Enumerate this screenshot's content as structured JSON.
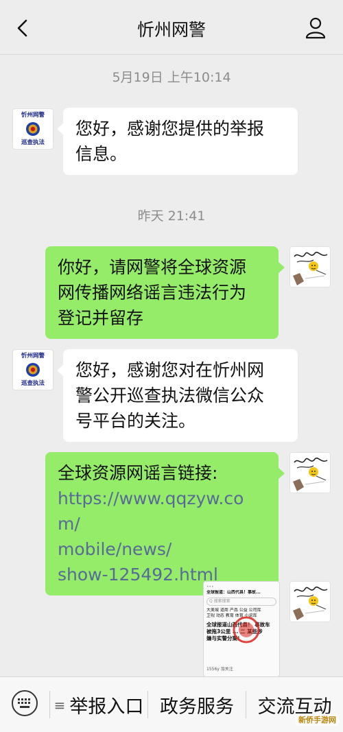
{
  "header": {
    "title": "忻州网警"
  },
  "chat": {
    "timestamp1": "5月19日 上午10:14",
    "timestamp2": "昨天 21:41",
    "msg1": [
      "您好，感谢您提供的举报",
      "信息。"
    ],
    "msg2": [
      "你好，请网警将全球资源",
      "网传播网络谣言违法行为",
      "登记并留存"
    ],
    "msg3": [
      "您好，感谢您对在忻州网",
      "警公开巡查执法微信公众",
      "号平台的关注。"
    ],
    "msg4_prefix": "全球资源网谣言链接:",
    "msg4_link": [
      "https://www.qqzyw.com/",
      "mobile/news/",
      "show-125492.html"
    ]
  },
  "police_avatar": {
    "line1": "忻州网警",
    "line2": "巡查执法"
  },
  "image_msg": {
    "headline": "全球报道：山西代县！事故...",
    "search": "Q 搜索搜索",
    "tabs": "大美城 道商 产品 公益 公司库",
    "tabs2": "卫视 动态 教育 体育 小说库",
    "big1": "全球报道山西代县！ 事故车",
    "big2": "被拖3公里 ... 二 某些涉",
    "big3": "嫌与实警分案！",
    "footer": "1556y   加关注"
  },
  "bottom_bar": {
    "menu1": "举报入口",
    "menu2": "政务服务",
    "menu3": "交流互动",
    "menu_mark": "≡",
    "watermark": "新侨手游网"
  },
  "colors": {
    "bubble_out": "#95ec69",
    "bubble_in": "#ffffff",
    "background": "#ededed",
    "link": "#576b95"
  }
}
